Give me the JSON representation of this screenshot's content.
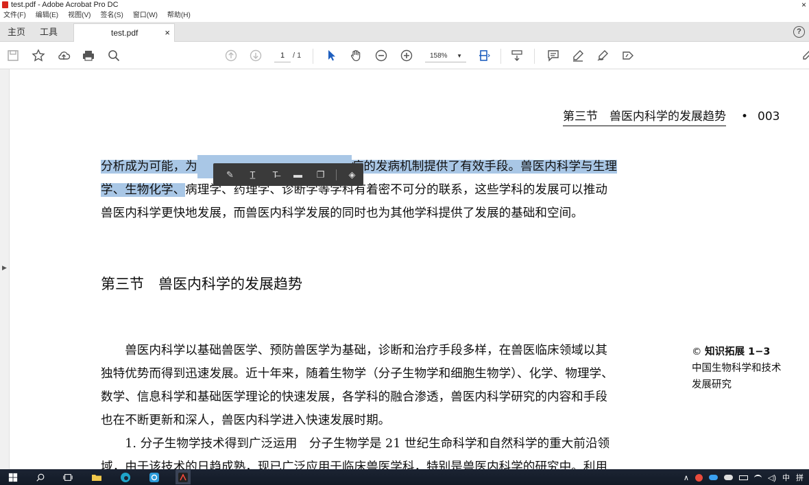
{
  "window": {
    "title": "test.pdf - Adobe Acrobat Pro DC",
    "close_glyph": "×"
  },
  "menu": [
    "文件(F)",
    "编辑(E)",
    "视图(V)",
    "签名(S)",
    "窗口(W)",
    "帮助(H)"
  ],
  "tabs": {
    "home": "主页",
    "tools": "工具",
    "doc": "test.pdf",
    "doc_close": "×",
    "help": "?"
  },
  "toolbar": {
    "page_current": "1",
    "page_total": "/ 1",
    "zoom": "158%"
  },
  "document": {
    "running_head_title": "第三节　兽医内科学的发展趋势",
    "running_head_bullet": "•",
    "running_head_page": "003",
    "para1": {
      "line1_hl_a": "分析成为可能，为",
      "line1_hl_b": "病的发病机制提供了有效手段。兽医内科学与生理",
      "line2_hl_a": "学、生物化学、",
      "line2_rest": "病理学、药理学、诊断学等学科有着密不可分的联系，这些学科的发展可以推动",
      "line3": "兽医内科学更快地发展，而兽医内科学发展的同时也为其他学科提供了发展的基础和空间。"
    },
    "section_heading": "第三节　兽医内科学的发展趋势",
    "para2": [
      "　　兽医内科学以基础兽医学、预防兽医学为基础，诊断和治疗手段多样，在兽医临床领域以其",
      "独特优势而得到迅速发展。近十年来，随着生物学（分子生物学和细胞生物学）、化学、物理学、",
      "数学、信息科学和基础医学理论的快速发展，各学科的融合渗透，兽医内科学研究的内容和手段",
      "也在不断更新和深人，兽医内科学进入快速发展时期。",
      "　　1. 分子生物学技术得到广泛运用　分子生物学是 21 世纪生命科学和自然科学的重大前沿领",
      "域，由于该技术的日趋成熟，现已广泛应用于临床兽医学科，特别是兽医内科学的研究中。利用"
    ],
    "sidebar": {
      "line1": "知识拓展 1−3",
      "line2": "中国生物科学和技术",
      "line3": "发展研究"
    }
  },
  "taskbar": {
    "ime": "中",
    "ime2": "拼"
  }
}
